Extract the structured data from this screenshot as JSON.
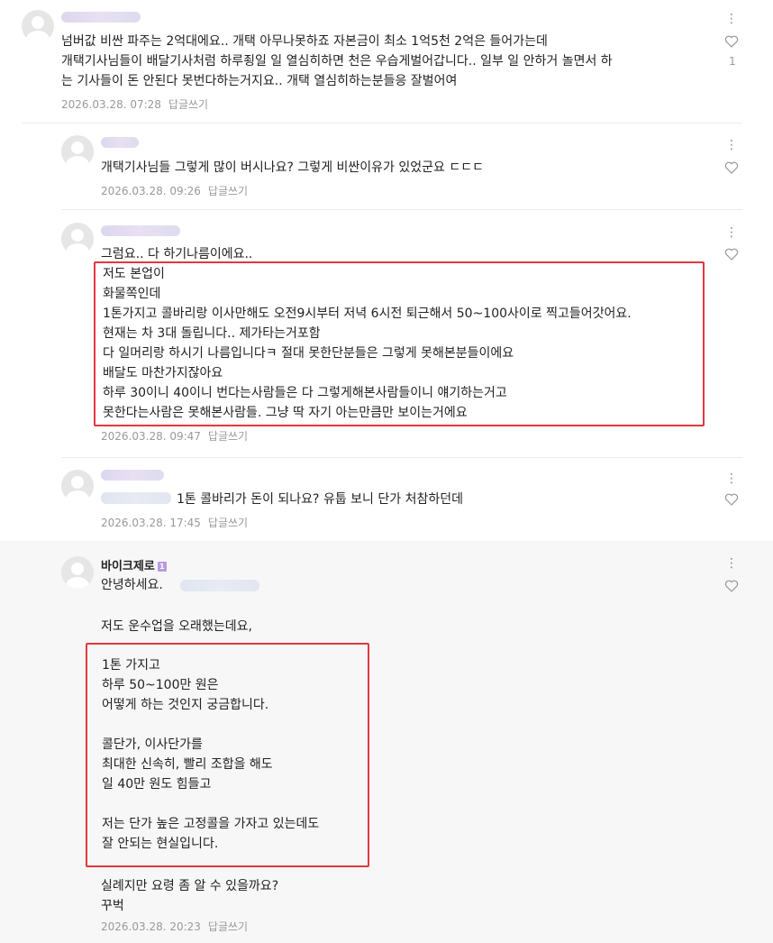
{
  "comments": [
    {
      "text": "넘버값 비싼 파주는 2억대에요.. 개택 아무나못하죠 자본금이 최소 1억5천 2억은 들어가는데\n개택기사님들이 배달기사처럼 하루죙일 일 열심히하면 천은 우습게벌어갑니다.. 일부 일 안하거 놀면서 하\n는 기사들이 돈 안된다 못번다하는거지요.. 개택 열심히하는분들응 잘벌어여",
      "date": "2026.03.28. 07:28",
      "reply": "답글쓰기",
      "likes": "1"
    },
    {
      "text": "개택기사님들 그렇게 많이 버시나요? 그렇게 비싼이유가 있었군요 ㄷㄷㄷ",
      "date": "2026.03.28. 09:26",
      "reply": "답글쓰기"
    },
    {
      "first_line": "그럼요.. 다 하기나름이에요..",
      "text": "저도 본업이\n화물쪽인데\n1톤가지고 콜바리랑 이사만해도 오전9시부터 저녁 6시전 퇴근해서 50~100사이로 찍고들어갓어요.\n현재는 차 3대 돌립니다.. 제가타는거포함\n다 일머리랑 하시기 나름입니다ㅋ 절대 못한단분들은 그렇게 못해본분들이에요\n배달도 마찬가지잖아요\n하루 30이니 40이니 번다는사람들은 다 그렇게해본사람들이니 얘기하는거고\n못한다는사람은 못해본사람들. 그냥 딱 자기 아는만큼만 보이는거에요",
      "date": "2026.03.28. 09:47",
      "reply": "답글쓰기"
    },
    {
      "text": "1톤 콜바리가 돈이 되나요? 유툽 보니 단가 처참하던데",
      "date": "2026.03.28. 17:45",
      "reply": "답글쓰기"
    },
    {
      "nickname": "바이크제로",
      "badge": "1",
      "greeting": "안녕하세요.",
      "line2": "저도 운수업을 오래했는데요,",
      "boxed": "1톤 가지고\n하루 50~100만 원은\n어떻게 하는 것인지 궁금합니다.\n\n콜단가, 이사단가를\n최대한 신속히, 빨리 조합을 해도\n일 40만 원도 힘들고\n\n저는 단가 높은 고정콜을 가자고 있는데도\n잘 안되는 현실입니다.",
      "closing": "실례지만 요령 좀 알 수 있을까요?\n꾸벅",
      "date": "2026.03.28. 20:23",
      "reply": "답글쓰기"
    }
  ],
  "icons": {
    "more": "more-vertical-icon",
    "like": "heart-icon"
  },
  "colors": {
    "highlight_box": "#e0393e",
    "meta_text": "#999999",
    "highlight_bg": "#f7f7f7"
  }
}
